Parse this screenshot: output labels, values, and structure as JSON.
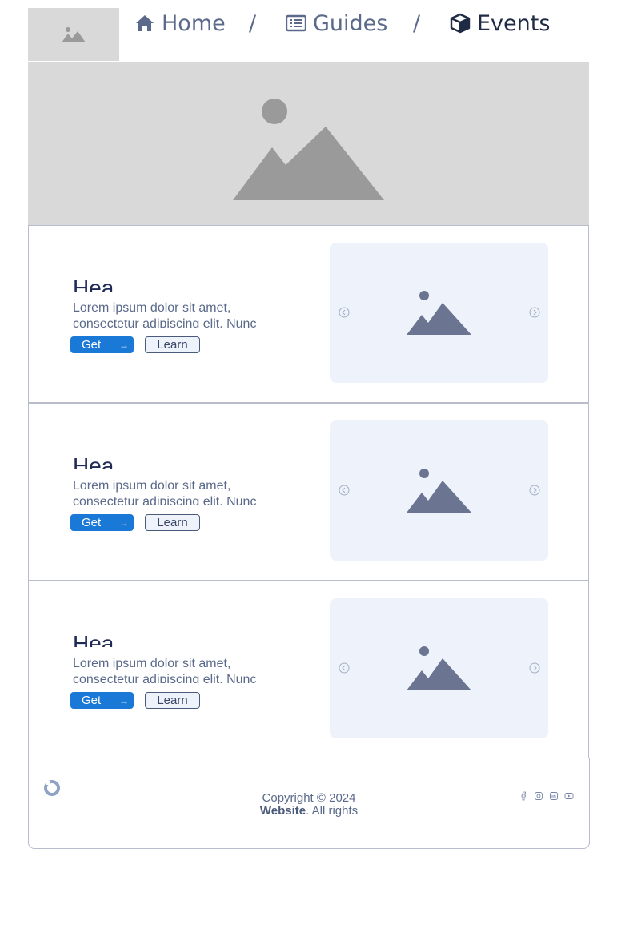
{
  "header": {
    "breadcrumb": [
      {
        "label": "Home",
        "icon": "home-icon"
      },
      {
        "label": "Guides",
        "icon": "list-icon"
      },
      {
        "label": "Events",
        "icon": "box-icon"
      }
    ],
    "separator": "/"
  },
  "cards": [
    {
      "heading": "Hea",
      "body": "Lorem ipsum dolor sit amet, consectetur adipiscing elit. Nunc",
      "primary_label": "Get",
      "secondary_label": "Learn"
    },
    {
      "heading": "Hea",
      "body": "Lorem ipsum dolor sit amet, consectetur adipiscing elit. Nunc",
      "primary_label": "Get",
      "secondary_label": "Learn"
    },
    {
      "heading": "Hea",
      "body": "Lorem ipsum dolor sit amet, consectetur adipiscing elit. Nunc",
      "primary_label": "Get",
      "secondary_label": "Learn"
    }
  ],
  "footer": {
    "copyright": "Copyright © 2024",
    "site_name": "Website",
    "rights": ". All rights",
    "social_icons": [
      "facebook-icon",
      "instagram-icon",
      "linkedin-icon",
      "youtube-icon"
    ]
  },
  "colors": {
    "primary": "#1a78d6",
    "heading": "#1f2a56",
    "placeholder_bg": "#d9d9d9",
    "media_bg": "#eef3fb"
  }
}
